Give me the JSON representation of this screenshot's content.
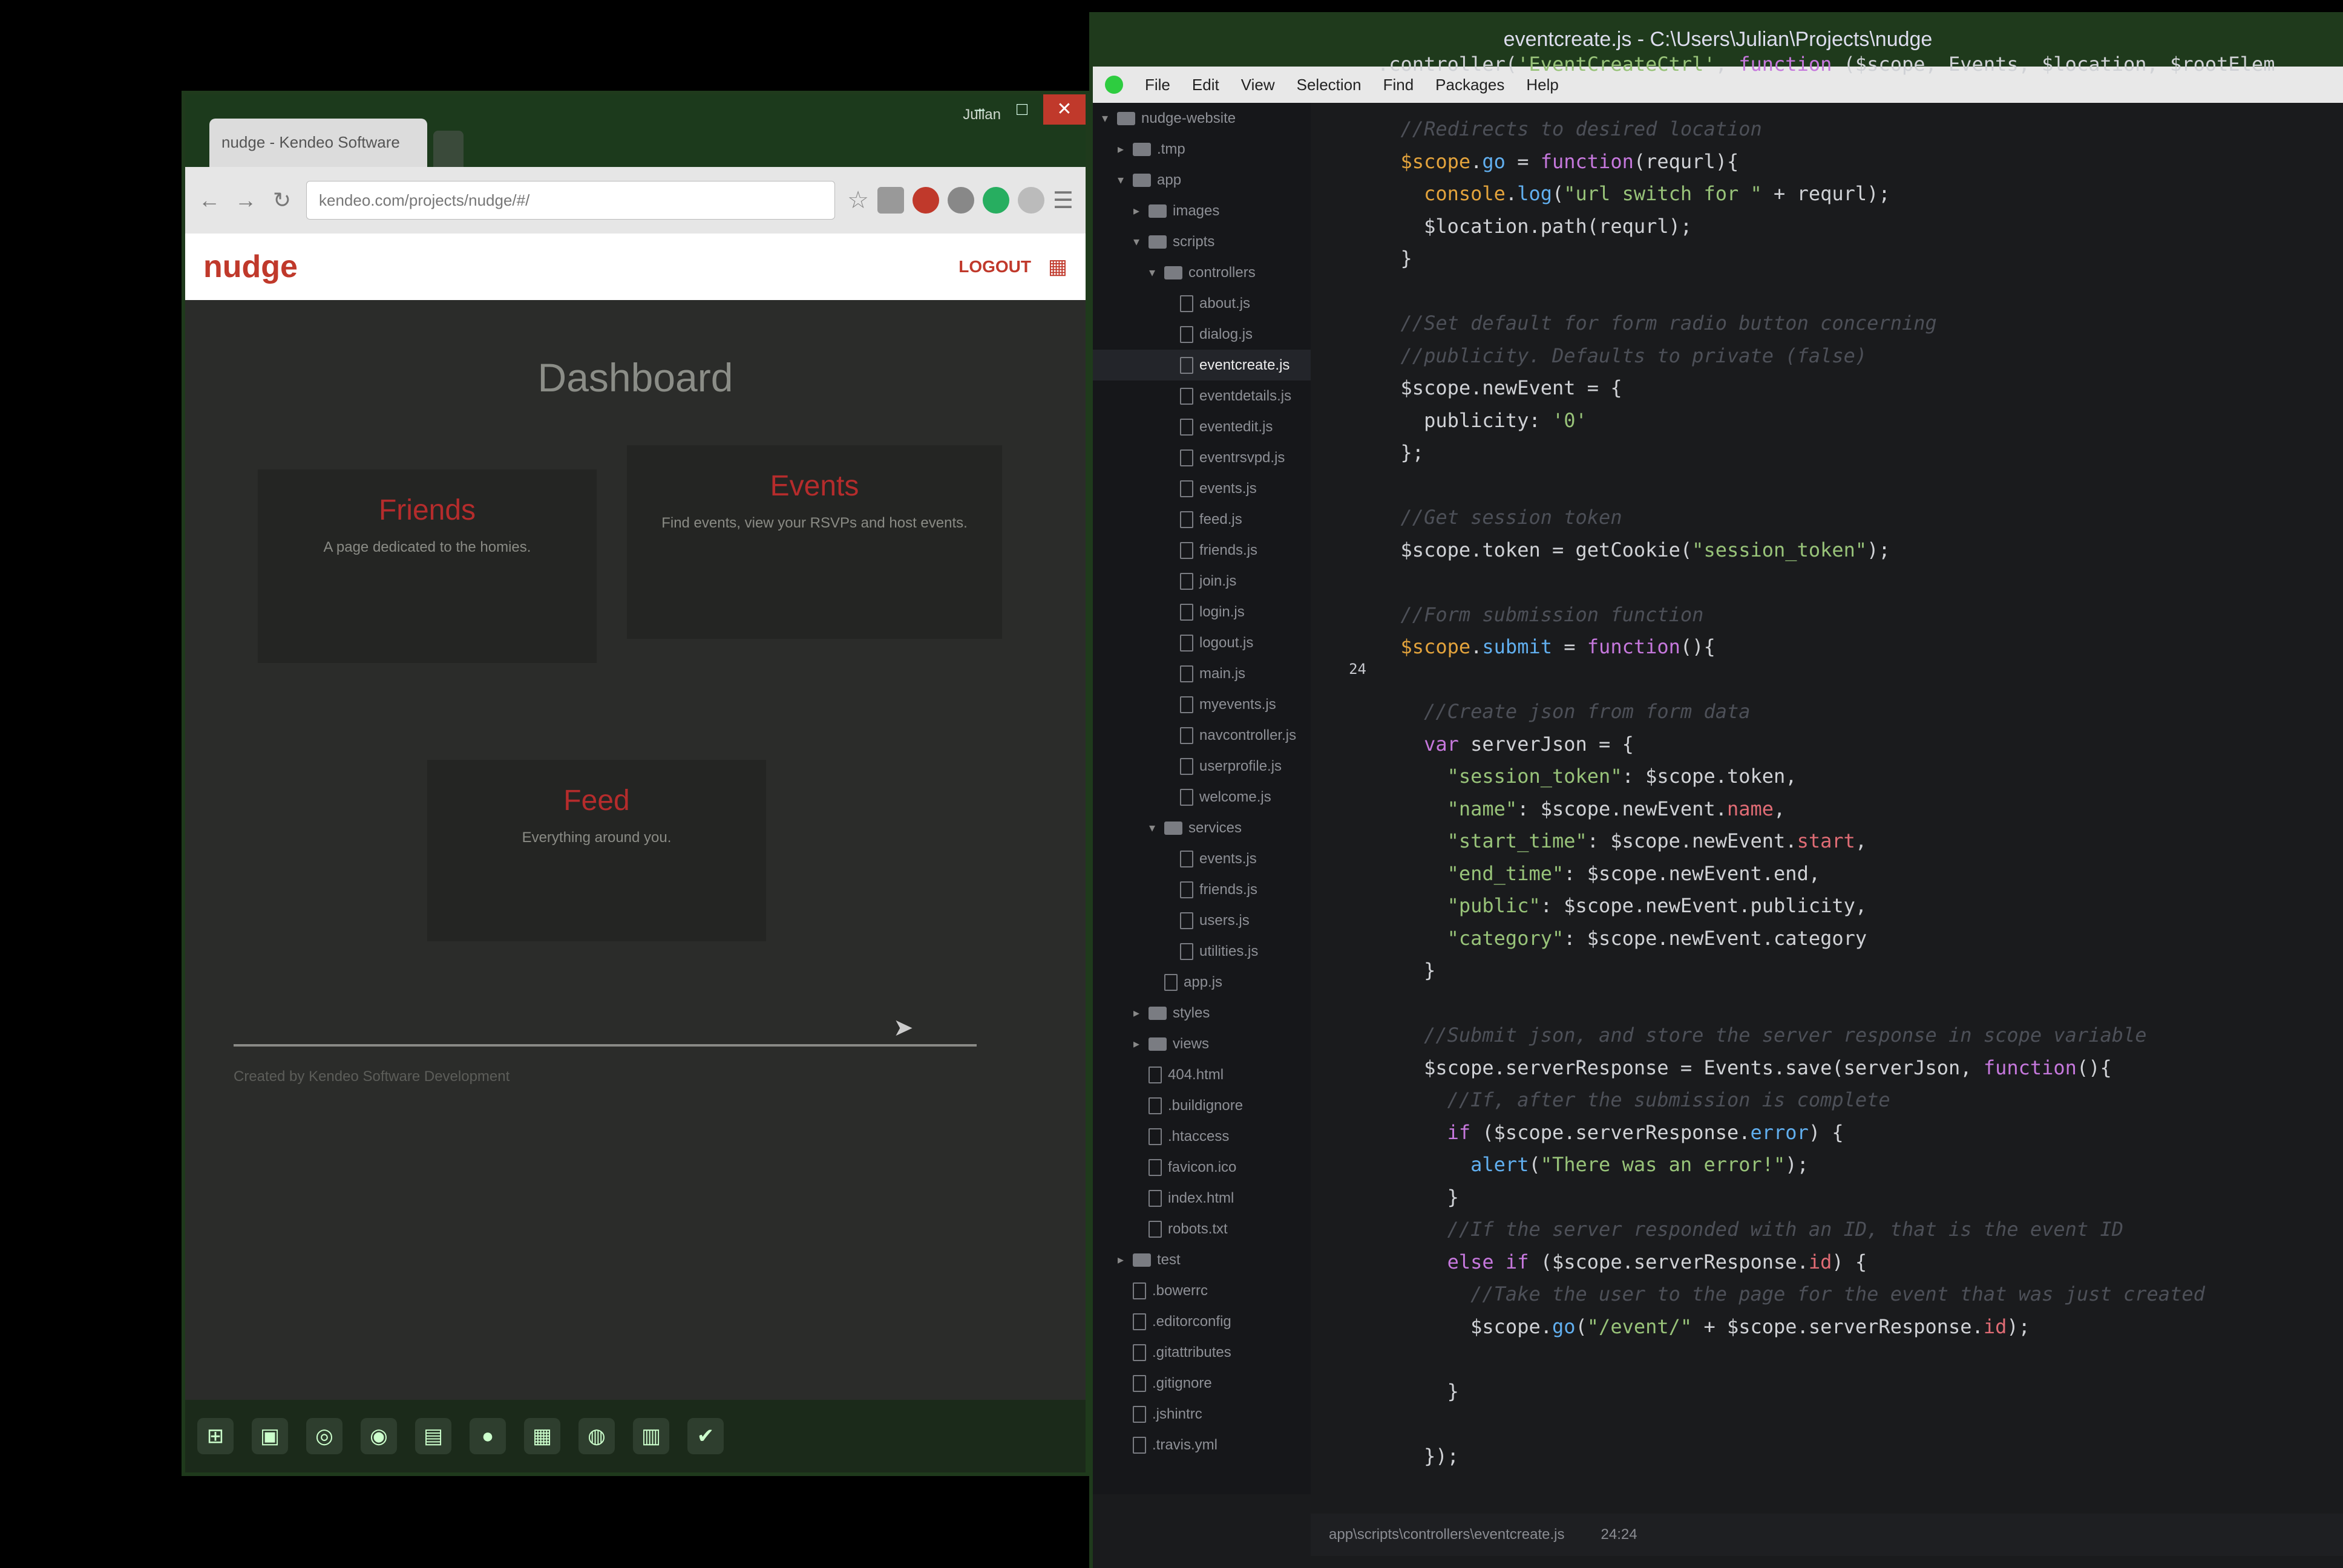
{
  "browser": {
    "tab_title": "nudge - Kendeo Software",
    "profile_name": "Julian",
    "window_controls": {
      "minimize": "–",
      "maximize": "□",
      "close": "✕"
    },
    "address": "kendeo.com/projects/nudge/#/",
    "site": {
      "logo": "nudge",
      "logout": "LOGOUT",
      "title": "Dashboard",
      "cards": [
        {
          "title": "Friends",
          "desc": "A page dedicated to the homies."
        },
        {
          "title": "Events",
          "desc": "Find events, view your RSVPs and host events."
        },
        {
          "title": "Feed",
          "desc": "Everything around you."
        }
      ],
      "footer": "Created by Kendeo Software Development"
    },
    "taskbar_icons": [
      "windows-icon",
      "explorer-icon",
      "search-icon",
      "chrome-icon",
      "app-icon",
      "media-icon",
      "network-icon",
      "utility-icon",
      "terminal-icon",
      "steam-icon"
    ]
  },
  "editor": {
    "title": "eventcreate.js - C:\\Users\\Julian\\Projects\\nudge",
    "menu": [
      "File",
      "Edit",
      "View",
      "Selection",
      "Find",
      "Packages",
      "Help"
    ],
    "tree": [
      {
        "depth": 0,
        "kind": "folder",
        "open": true,
        "label": "nudge-website"
      },
      {
        "depth": 1,
        "kind": "folder",
        "open": false,
        "label": ".tmp"
      },
      {
        "depth": 1,
        "kind": "folder",
        "open": true,
        "label": "app"
      },
      {
        "depth": 2,
        "kind": "folder",
        "open": false,
        "label": "images"
      },
      {
        "depth": 2,
        "kind": "folder",
        "open": true,
        "label": "scripts"
      },
      {
        "depth": 3,
        "kind": "folder",
        "open": true,
        "label": "controllers"
      },
      {
        "depth": 4,
        "kind": "file",
        "label": "about.js"
      },
      {
        "depth": 4,
        "kind": "file",
        "label": "dialog.js"
      },
      {
        "depth": 4,
        "kind": "file",
        "label": "eventcreate.js",
        "selected": true
      },
      {
        "depth": 4,
        "kind": "file",
        "label": "eventdetails.js"
      },
      {
        "depth": 4,
        "kind": "file",
        "label": "eventedit.js"
      },
      {
        "depth": 4,
        "kind": "file",
        "label": "eventrsvpd.js"
      },
      {
        "depth": 4,
        "kind": "file",
        "label": "events.js"
      },
      {
        "depth": 4,
        "kind": "file",
        "label": "feed.js"
      },
      {
        "depth": 4,
        "kind": "file",
        "label": "friends.js"
      },
      {
        "depth": 4,
        "kind": "file",
        "label": "join.js"
      },
      {
        "depth": 4,
        "kind": "file",
        "label": "login.js"
      },
      {
        "depth": 4,
        "kind": "file",
        "label": "logout.js"
      },
      {
        "depth": 4,
        "kind": "file",
        "label": "main.js"
      },
      {
        "depth": 4,
        "kind": "file",
        "label": "myevents.js"
      },
      {
        "depth": 4,
        "kind": "file",
        "label": "navcontroller.js"
      },
      {
        "depth": 4,
        "kind": "file",
        "label": "userprofile.js"
      },
      {
        "depth": 4,
        "kind": "file",
        "label": "welcome.js"
      },
      {
        "depth": 3,
        "kind": "folder",
        "open": true,
        "label": "services"
      },
      {
        "depth": 4,
        "kind": "file",
        "label": "events.js"
      },
      {
        "depth": 4,
        "kind": "file",
        "label": "friends.js"
      },
      {
        "depth": 4,
        "kind": "file",
        "label": "users.js"
      },
      {
        "depth": 4,
        "kind": "file",
        "label": "utilities.js"
      },
      {
        "depth": 3,
        "kind": "file",
        "label": "app.js"
      },
      {
        "depth": 2,
        "kind": "folder",
        "open": false,
        "label": "styles"
      },
      {
        "depth": 2,
        "kind": "folder",
        "open": false,
        "label": "views"
      },
      {
        "depth": 2,
        "kind": "file",
        "label": "404.html"
      },
      {
        "depth": 2,
        "kind": "file",
        "label": ".buildignore"
      },
      {
        "depth": 2,
        "kind": "file",
        "label": ".htaccess"
      },
      {
        "depth": 2,
        "kind": "file",
        "label": "favicon.ico"
      },
      {
        "depth": 2,
        "kind": "file",
        "label": "index.html"
      },
      {
        "depth": 2,
        "kind": "file",
        "label": "robots.txt"
      },
      {
        "depth": 1,
        "kind": "folder",
        "open": false,
        "label": "test"
      },
      {
        "depth": 1,
        "kind": "file",
        "label": ".bowerrc"
      },
      {
        "depth": 1,
        "kind": "file",
        "label": ".editorconfig"
      },
      {
        "depth": 1,
        "kind": "file",
        "label": ".gitattributes"
      },
      {
        "depth": 1,
        "kind": "file",
        "label": ".gitignore"
      },
      {
        "depth": 1,
        "kind": "file",
        "label": ".jshintrc"
      },
      {
        "depth": 1,
        "kind": "file",
        "label": ".travis.yml"
      }
    ],
    "line_numbers": [
      "",
      "",
      "",
      "",
      "",
      "",
      "",
      "",
      "",
      "",
      "",
      "",
      "",
      "",
      "",
      "",
      "",
      "24",
      "",
      "",
      "",
      "",
      "",
      "",
      "",
      "",
      "",
      "",
      "",
      "",
      "",
      "",
      "",
      "",
      "",
      "",
      "",
      "",
      "",
      "",
      "",
      "",
      "",
      ""
    ],
    "current_line": "24",
    "code": [
      [
        [
          "c-plain",
          ".controller("
        ],
        [
          "c-str",
          "'EventCreateCtrl'"
        ],
        [
          "c-plain",
          ", "
        ],
        [
          "c-kw",
          "function"
        ],
        [
          "c-plain",
          " ($scope, Events, $location, $rootElem"
        ]
      ],
      [],
      [
        [
          "c-cmt",
          "  //Redirects to desired location"
        ]
      ],
      [
        [
          "c-var",
          "  $scope"
        ],
        [
          "c-plain",
          "."
        ],
        [
          "c-fn",
          "go"
        ],
        [
          "c-plain",
          " = "
        ],
        [
          "c-kw",
          "function"
        ],
        [
          "c-plain",
          "(requrl){"
        ]
      ],
      [
        [
          "c-var",
          "    console"
        ],
        [
          "c-plain",
          "."
        ],
        [
          "c-fn",
          "log"
        ],
        [
          "c-plain",
          "("
        ],
        [
          "c-str",
          "\"url switch for \""
        ],
        [
          "c-plain",
          " + requrl);"
        ]
      ],
      [
        [
          "c-plain",
          "    $location.path(requrl);"
        ]
      ],
      [
        [
          "c-plain",
          "  }"
        ]
      ],
      [],
      [
        [
          "c-cmt",
          "  //Set default for form radio button concerning"
        ]
      ],
      [
        [
          "c-cmt",
          "  //publicity. Defaults to private (false)"
        ]
      ],
      [
        [
          "c-plain",
          "  $scope.newEvent = {"
        ]
      ],
      [
        [
          "c-plain",
          "    publicity: "
        ],
        [
          "c-str",
          "'0'"
        ]
      ],
      [
        [
          "c-plain",
          "  };"
        ]
      ],
      [],
      [
        [
          "c-cmt",
          "  //Get session token"
        ]
      ],
      [
        [
          "c-plain",
          "  $scope.token = getCookie("
        ],
        [
          "c-str",
          "\"session_token\""
        ],
        [
          "c-plain",
          ");"
        ]
      ],
      [],
      [
        [
          "c-cmt",
          "  //Form submission function"
        ]
      ],
      [
        [
          "c-var",
          "  $scope"
        ],
        [
          "c-plain",
          "."
        ],
        [
          "c-fn",
          "submit"
        ],
        [
          "c-plain",
          " = "
        ],
        [
          "c-kw",
          "function"
        ],
        [
          "c-plain",
          "(){"
        ]
      ],
      [],
      [
        [
          "c-cmt",
          "    //Create json from form data"
        ]
      ],
      [
        [
          "c-kw",
          "    var"
        ],
        [
          "c-plain",
          " serverJson = {"
        ]
      ],
      [
        [
          "c-str",
          "      \"session_token\""
        ],
        [
          "c-plain",
          ": $scope.token,"
        ]
      ],
      [
        [
          "c-str",
          "      \"name\""
        ],
        [
          "c-plain",
          ": $scope.newEvent."
        ],
        [
          "c-prop",
          "name"
        ],
        [
          "c-plain",
          ","
        ]
      ],
      [
        [
          "c-str",
          "      \"start_time\""
        ],
        [
          "c-plain",
          ": $scope.newEvent."
        ],
        [
          "c-prop",
          "start"
        ],
        [
          "c-plain",
          ","
        ]
      ],
      [
        [
          "c-str",
          "      \"end_time\""
        ],
        [
          "c-plain",
          ": $scope.newEvent.end,"
        ]
      ],
      [
        [
          "c-str",
          "      \"public\""
        ],
        [
          "c-plain",
          ": $scope.newEvent.publicity,"
        ]
      ],
      [
        [
          "c-str",
          "      \"category\""
        ],
        [
          "c-plain",
          ": $scope.newEvent.category"
        ]
      ],
      [
        [
          "c-plain",
          "    }"
        ]
      ],
      [],
      [
        [
          "c-cmt",
          "    //Submit json, and store the server response in scope variable"
        ]
      ],
      [
        [
          "c-plain",
          "    $scope.serverResponse = Events.save(serverJson, "
        ],
        [
          "c-kw",
          "function"
        ],
        [
          "c-plain",
          "(){"
        ]
      ],
      [
        [
          "c-cmt",
          "      //If, after the submission is complete"
        ]
      ],
      [
        [
          "c-kw",
          "      if"
        ],
        [
          "c-plain",
          " ($scope.serverResponse."
        ],
        [
          "c-fn",
          "error"
        ],
        [
          "c-plain",
          ") {"
        ]
      ],
      [
        [
          "c-fn",
          "        alert"
        ],
        [
          "c-plain",
          "("
        ],
        [
          "c-str",
          "\"There was an error!\""
        ],
        [
          "c-plain",
          ");"
        ]
      ],
      [
        [
          "c-plain",
          "      }"
        ]
      ],
      [
        [
          "c-cmt",
          "      //If the server responded with an ID, that is the event ID"
        ]
      ],
      [
        [
          "c-kw",
          "      else if"
        ],
        [
          "c-plain",
          " ($scope.serverResponse."
        ],
        [
          "c-prop",
          "id"
        ],
        [
          "c-plain",
          ") {"
        ]
      ],
      [
        [
          "c-cmt",
          "        //Take the user to the page for the event that was just created"
        ]
      ],
      [
        [
          "c-plain",
          "        $scope."
        ],
        [
          "c-fn",
          "go"
        ],
        [
          "c-plain",
          "("
        ],
        [
          "c-str",
          "\"/event/\""
        ],
        [
          "c-plain",
          " + $scope.serverResponse."
        ],
        [
          "c-prop",
          "id"
        ],
        [
          "c-plain",
          ");"
        ]
      ],
      [],
      [
        [
          "c-plain",
          "      }"
        ]
      ],
      [],
      [
        [
          "c-plain",
          "    });"
        ]
      ]
    ],
    "status": {
      "path": "app\\scripts\\controllers\\eventcreate.js",
      "cursor": "24:24"
    }
  }
}
